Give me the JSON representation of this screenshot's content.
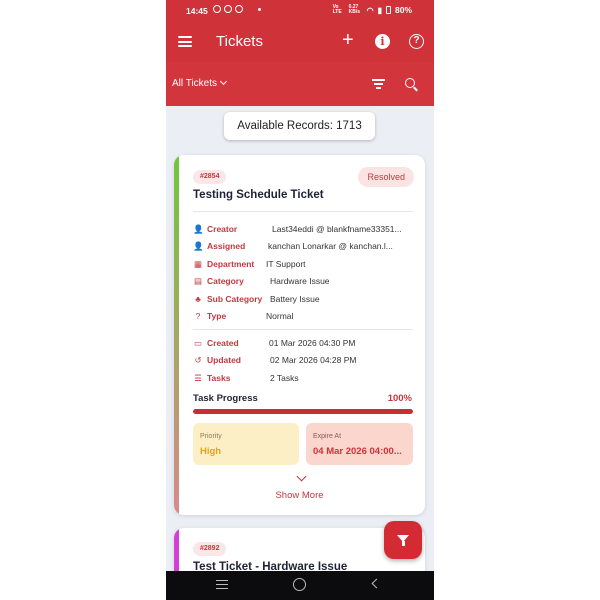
{
  "status_bar": {
    "time": "14:45",
    "network": "Vo LTE",
    "speed": "0.27 KB/s",
    "battery": "80%"
  },
  "app_bar": {
    "title": "Tickets",
    "add_icon": "plus-icon",
    "info_icon": "info-icon",
    "help_icon": "help-icon",
    "help_glyph": "?",
    "info_glyph": "i",
    "plus_glyph": "+"
  },
  "filter_bar": {
    "view_label": "All Tickets",
    "sort_icon": "sort-icon",
    "search_icon": "search-icon"
  },
  "records": {
    "label": "Available Records: 1713"
  },
  "tickets": [
    {
      "id": "#2854",
      "status": "Resolved",
      "title": "Testing Schedule Ticket",
      "accent_color": "#6ec73b",
      "fields": [
        {
          "label": "Creator",
          "value": "Last34eddi @ blankfname33351...",
          "icon": "person-icon",
          "glyph": "👤"
        },
        {
          "label": "Assigned",
          "value": "kanchan Lonarkar @ kanchan.l...",
          "icon": "assigned-person-icon",
          "glyph": "👤"
        },
        {
          "label": "Department",
          "value": "IT Support",
          "icon": "building-icon",
          "glyph": "▦"
        },
        {
          "label": "Category",
          "value": "Hardware Issue",
          "icon": "category-icon",
          "glyph": "▤"
        },
        {
          "label": "Sub Category",
          "value": "Battery Issue",
          "icon": "hierarchy-icon",
          "glyph": "♣"
        },
        {
          "label": "Type",
          "value": "Normal",
          "icon": "question-icon",
          "glyph": "?"
        }
      ],
      "dates": [
        {
          "label": "Created",
          "value": "01 Mar 2026 04:30 PM",
          "icon": "calendar-icon",
          "glyph": "▭"
        },
        {
          "label": "Updated",
          "value": "02 Mar 2026 04:28 PM",
          "icon": "history-icon",
          "glyph": "↺"
        },
        {
          "label": "Tasks",
          "value": "2 Tasks",
          "icon": "task-list-icon",
          "glyph": "☰"
        }
      ],
      "progress": {
        "label": "Task Progress",
        "percent_text": "100%",
        "value": 100
      },
      "priority": {
        "label": "Priority",
        "value": "High"
      },
      "expire": {
        "label": "Expire At",
        "value": "04 Mar 2026 04:00..."
      },
      "show_more": "Show More"
    },
    {
      "id": "#2892",
      "title": "Test Ticket - Hardware Issue",
      "accent_color": "#d23ed6"
    }
  ],
  "fab": {
    "icon": "filter-icon"
  },
  "colors": {
    "primary": "#d0323a",
    "accent_text": "#c0393f",
    "priority_bg": "#fdefc5",
    "expire_bg": "#fbd6cc"
  }
}
